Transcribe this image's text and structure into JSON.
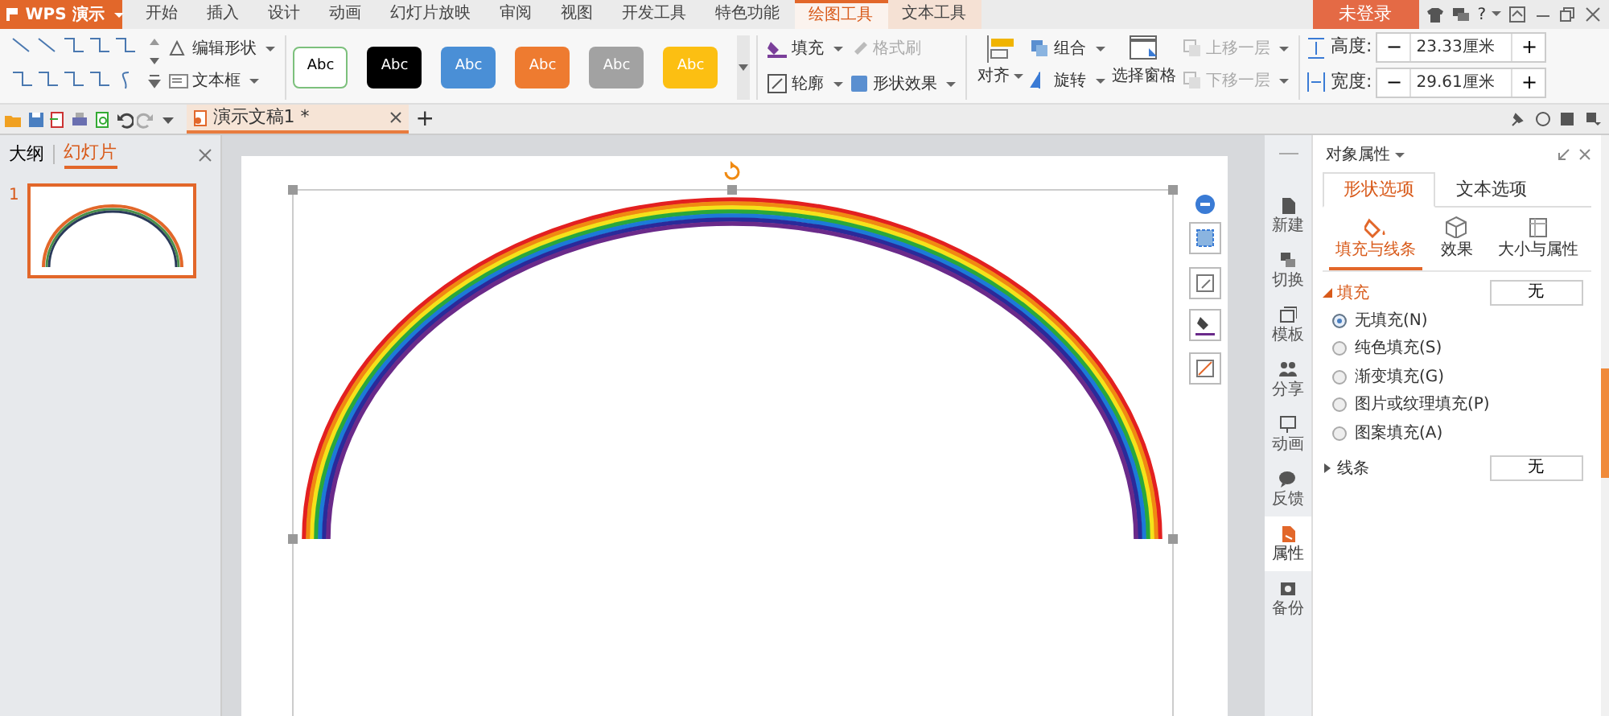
{
  "app_button": {
    "label": "WPS 演示"
  },
  "menu_tabs": [
    {
      "label": "开始",
      "selected": false,
      "contextual": false
    },
    {
      "label": "插入",
      "selected": false,
      "contextual": false
    },
    {
      "label": "设计",
      "selected": false,
      "contextual": false
    },
    {
      "label": "动画",
      "selected": false,
      "contextual": false
    },
    {
      "label": "幻灯片放映",
      "selected": false,
      "contextual": false
    },
    {
      "label": "审阅",
      "selected": false,
      "contextual": false
    },
    {
      "label": "视图",
      "selected": false,
      "contextual": false
    },
    {
      "label": "开发工具",
      "selected": false,
      "contextual": false
    },
    {
      "label": "特色功能",
      "selected": false,
      "contextual": false
    },
    {
      "label": "绘图工具",
      "selected": true,
      "contextual": true
    },
    {
      "label": "文本工具",
      "selected": false,
      "contextual": true
    }
  ],
  "login_button": "未登录",
  "help": "?",
  "ribbon": {
    "shape_tools": [
      {
        "label": "编辑形状",
        "dropdown": true
      },
      {
        "label": "文本框",
        "dropdown": true
      }
    ],
    "style_presets": [
      {
        "label": "Abc",
        "color": "#ffffff",
        "outlined": true
      },
      {
        "label": "Abc",
        "color": "#000000",
        "outlined": false
      },
      {
        "label": "Abc",
        "color": "#4a8fd6",
        "outlined": false
      },
      {
        "label": "Abc",
        "color": "#ee7b30",
        "outlined": false
      },
      {
        "label": "Abc",
        "color": "#a2a2a2",
        "outlined": false
      },
      {
        "label": "Abc",
        "color": "#fcbf12",
        "outlined": false
      }
    ],
    "format_tools": [
      {
        "label": "填充",
        "dropdown": true,
        "disabled": false
      },
      {
        "label": "格式刷",
        "dropdown": false,
        "disabled": true
      },
      {
        "label": "轮廓",
        "dropdown": true,
        "disabled": false
      },
      {
        "label": "形状效果",
        "dropdown": true,
        "disabled": false
      }
    ],
    "arrange": [
      {
        "kind": "large",
        "label": "对齐",
        "dropdown": true
      },
      {
        "kind": "stack",
        "items": [
          {
            "label": "组合",
            "dropdown": true,
            "disabled": false
          },
          {
            "label": "旋转",
            "dropdown": true,
            "disabled": false
          }
        ]
      },
      {
        "kind": "large",
        "label": "选择窗格",
        "dropdown": false
      },
      {
        "kind": "stack",
        "items": [
          {
            "label": "上移一层",
            "dropdown": true,
            "disabled": true
          },
          {
            "label": "下移一层",
            "dropdown": true,
            "disabled": true
          }
        ]
      }
    ],
    "size": [
      {
        "label": "高度:",
        "value": "23.33厘米",
        "decrement": "−",
        "increment": "+"
      },
      {
        "label": "宽度:",
        "value": "29.61厘米",
        "decrement": "−",
        "increment": "+"
      }
    ]
  },
  "doc_tab": {
    "title": "演示文稿1 *"
  },
  "new_tab": "+",
  "left_panel": {
    "tabs": [
      {
        "label": "大纲",
        "selected": false
      },
      {
        "label": "幻灯片",
        "selected": true
      }
    ],
    "slides": [
      {
        "number": "1",
        "selected": true
      }
    ]
  },
  "side_bar": [
    {
      "label": "新建",
      "selected": false
    },
    {
      "label": "切换",
      "selected": false
    },
    {
      "label": "模板",
      "selected": false
    },
    {
      "label": "分享",
      "selected": false
    },
    {
      "label": "动画",
      "selected": false
    },
    {
      "label": "反馈",
      "selected": false
    },
    {
      "label": "属性",
      "selected": true
    },
    {
      "label": "备份",
      "selected": false
    }
  ],
  "properties": {
    "title": "对象属性",
    "tabs": [
      {
        "label": "形状选项",
        "selected": true
      },
      {
        "label": "文本选项",
        "selected": false
      }
    ],
    "subtabs": [
      {
        "label": "填充与线条",
        "selected": true
      },
      {
        "label": "效果",
        "selected": false
      },
      {
        "label": "大小与属性",
        "selected": false
      }
    ],
    "sections": [
      {
        "label": "填充",
        "expanded": true,
        "value": "无",
        "options": [
          {
            "label": "无填充(N)",
            "selected": true
          },
          {
            "label": "纯色填充(S)",
            "selected": false
          },
          {
            "label": "渐变填充(G)",
            "selected": false
          },
          {
            "label": "图片或纹理填充(P)",
            "selected": false
          },
          {
            "label": "图案填充(A)",
            "selected": false
          }
        ]
      },
      {
        "label": "线条",
        "expanded": false,
        "value": "无"
      }
    ]
  }
}
